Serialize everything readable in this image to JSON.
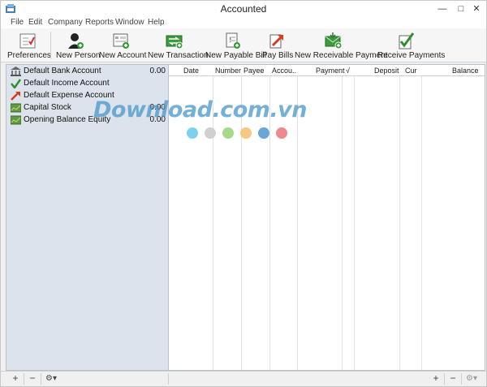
{
  "window": {
    "title": "Accounted",
    "controls": {
      "minimize": "—",
      "maximize": "□",
      "close": "✕"
    }
  },
  "menubar": {
    "items": [
      "File",
      "Edit",
      "Company",
      "Reports",
      "Window",
      "Help"
    ]
  },
  "toolbar": {
    "buttons": [
      {
        "label": "Preferences",
        "icon": "preferences-icon"
      },
      {
        "label": "New Person",
        "icon": "new-person-icon"
      },
      {
        "label": "New Account",
        "icon": "new-account-icon"
      },
      {
        "label": "New Transaction",
        "icon": "new-transaction-icon"
      },
      {
        "label": "New Payable Bill",
        "icon": "new-payable-bill-icon"
      },
      {
        "label": "Pay Bills",
        "icon": "pay-bills-icon"
      },
      {
        "label": "New Receivable Payment",
        "icon": "new-receivable-payment-icon"
      },
      {
        "label": "Receive Payments",
        "icon": "receive-payments-icon"
      }
    ]
  },
  "accounts": [
    {
      "name": "Default Bank Account",
      "balance": "0.00",
      "icon": "bank-icon"
    },
    {
      "name": "Default Income Account",
      "balance": "",
      "icon": "income-check-icon"
    },
    {
      "name": "Default Expense Account",
      "balance": "",
      "icon": "expense-arrow-icon"
    },
    {
      "name": "Capital Stock",
      "balance": "0.00",
      "icon": "equity-chart-icon"
    },
    {
      "name": "Opening Balance Equity",
      "balance": "0.00",
      "icon": "equity-chart-icon"
    }
  ],
  "ledger": {
    "columns": [
      "Date",
      "Number",
      "Payee",
      "Accou...",
      "Payment",
      "√",
      "Deposit",
      "Cur",
      "Balance"
    ]
  },
  "bottombar": {
    "add": "+",
    "remove": "−",
    "gear": "⚙▾"
  },
  "watermark": {
    "text": "Download.com.vn",
    "dot_colors": [
      "#7fd0f0",
      "#d0d0d0",
      "#a8d88a",
      "#f8c880",
      "#6aa6d8",
      "#f08890"
    ]
  }
}
